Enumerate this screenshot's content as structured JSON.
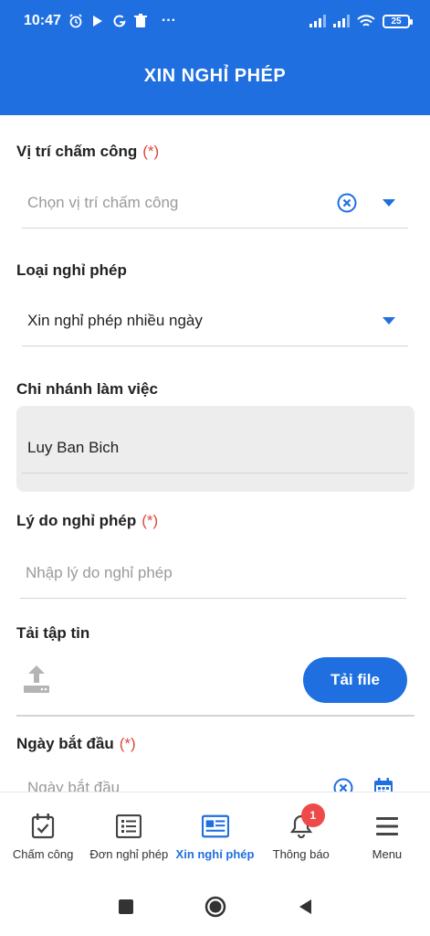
{
  "status_bar": {
    "time": "10:47",
    "dots": "···",
    "battery": "25"
  },
  "header": {
    "title": "XIN NGHỈ PHÉP"
  },
  "form": {
    "location": {
      "label": "Vị trí chấm công",
      "required_mark": "(*)",
      "placeholder": "Chọn vị trí chấm công"
    },
    "leave_type": {
      "label": "Loại nghỉ phép",
      "value": "Xin nghỉ phép nhiều ngày"
    },
    "branch": {
      "label": "Chi nhánh làm việc",
      "value": "Luy Ban Bich"
    },
    "reason": {
      "label": "Lý do nghỉ phép",
      "required_mark": "(*)",
      "placeholder": "Nhập lý do nghỉ phép"
    },
    "upload": {
      "label": "Tải tập tin",
      "button_label": "Tải file"
    },
    "start_date": {
      "label": "Ngày bắt đầu",
      "required_mark": "(*)",
      "placeholder": "Ngày bắt đầu"
    }
  },
  "bottom_nav": {
    "items": [
      {
        "label": "Chấm công",
        "icon": "calendar-check-icon"
      },
      {
        "label": "Đơn nghỉ phép",
        "icon": "list-icon"
      },
      {
        "label": "Xin nghỉ phép",
        "icon": "newspaper-icon",
        "active": true
      },
      {
        "label": "Thông báo",
        "icon": "bell-icon",
        "badge": "1"
      },
      {
        "label": "Menu",
        "icon": "hamburger-icon"
      }
    ]
  },
  "colors": {
    "primary": "#1f6fe0",
    "required": "#e0463a",
    "badge": "#ef4a4a"
  }
}
